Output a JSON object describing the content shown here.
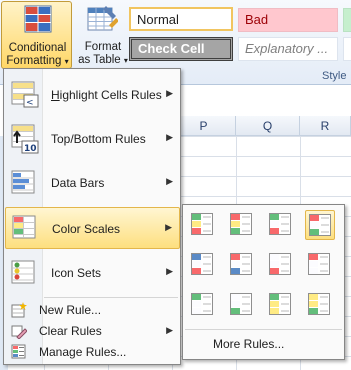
{
  "ribbon": {
    "conditional_formatting": {
      "line1": "Conditional",
      "line2": "Formatting"
    },
    "format_as_table": {
      "line1": "Format",
      "line2": "as Table"
    },
    "styles": {
      "normal": "Normal",
      "bad": "Bad",
      "check_cell": "Check Cell",
      "explanatory": "Explanatory ...",
      "group_label": "Style"
    }
  },
  "columns": [
    "P",
    "Q",
    "R"
  ],
  "menu": {
    "items": [
      {
        "label": "Highlight Cells Rules",
        "icon": "highlight-cells-icon",
        "has_submenu": true
      },
      {
        "label": "Top/Bottom Rules",
        "icon": "top-bottom-icon",
        "has_submenu": true
      },
      {
        "label": "Data Bars",
        "icon": "data-bars-icon",
        "has_submenu": true
      },
      {
        "label": "Color Scales",
        "icon": "color-scales-icon",
        "has_submenu": true,
        "highlighted": true
      },
      {
        "label": "Icon Sets",
        "icon": "icon-sets-icon",
        "has_submenu": true
      }
    ],
    "small_items": [
      {
        "label": "New Rule...",
        "icon": "new-rule-icon"
      },
      {
        "label": "Clear Rules",
        "icon": "clear-rules-icon",
        "has_submenu": true
      },
      {
        "label": "Manage Rules...",
        "icon": "manage-rules-icon"
      }
    ]
  },
  "color_scales_submenu": {
    "more_rules": "More Rules...",
    "scales": [
      [
        "#63be7b",
        "#ffeb84",
        "#f8696b"
      ],
      [
        "#f8696b",
        "#ffeb84",
        "#63be7b"
      ],
      [
        "#63be7b",
        "#fcfcff",
        "#f8696b"
      ],
      [
        "#f8696b",
        "#fcfcff",
        "#63be7b"
      ],
      [
        "#5a8ac6",
        "#fcfcff",
        "#f8696b"
      ],
      [
        "#f8696b",
        "#fcfcff",
        "#5a8ac6"
      ],
      [
        "#fcfcff",
        "#fcfcff",
        "#f8696b"
      ],
      [
        "#f8696b",
        "#fcfcff",
        "#fcfcff"
      ],
      [
        "#63be7b",
        "#fcfcff",
        "#fcfcff"
      ],
      [
        "#fcfcff",
        "#fcfcff",
        "#63be7b"
      ],
      [
        "#63be7b",
        "#ffeb84",
        "#ffeb84"
      ],
      [
        "#ffeb84",
        "#ffeb84",
        "#63be7b"
      ]
    ],
    "selected_index": 3
  }
}
